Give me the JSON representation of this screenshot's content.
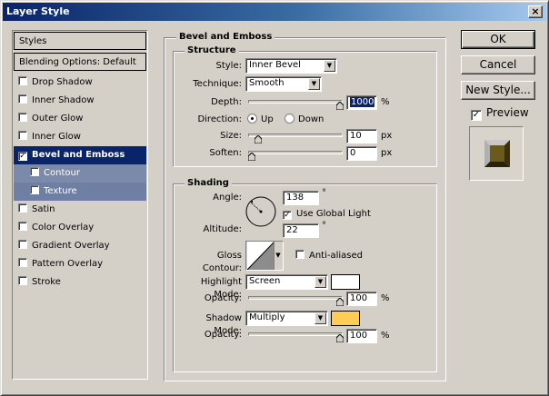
{
  "window": {
    "title": "Layer Style",
    "close_glyph": "×"
  },
  "styles_list": {
    "header": "Styles",
    "blending": "Blending Options: Default",
    "items": [
      {
        "label": "Drop Shadow",
        "checked": false
      },
      {
        "label": "Inner Shadow",
        "checked": false
      },
      {
        "label": "Outer Glow",
        "checked": false
      },
      {
        "label": "Inner Glow",
        "checked": false
      },
      {
        "label": "Bevel and Emboss",
        "checked": true
      },
      {
        "label": "Contour",
        "checked": false
      },
      {
        "label": "Texture",
        "checked": false
      },
      {
        "label": "Satin",
        "checked": false
      },
      {
        "label": "Color Overlay",
        "checked": false
      },
      {
        "label": "Gradient Overlay",
        "checked": false
      },
      {
        "label": "Pattern Overlay",
        "checked": false
      },
      {
        "label": "Stroke",
        "checked": false
      }
    ],
    "check_glyph": "✓"
  },
  "bevel": {
    "title": "Bevel and Emboss",
    "structure": {
      "title": "Structure",
      "style_label": "Style:",
      "style_value": "Inner Bevel",
      "technique_label": "Technique:",
      "technique_value": "Smooth",
      "depth_label": "Depth:",
      "depth_value": "1000",
      "depth_unit": "%",
      "direction_label": "Direction:",
      "dir_up": "Up",
      "dir_down": "Down",
      "size_label": "Size:",
      "size_value": "10",
      "size_unit": "px",
      "soften_label": "Soften:",
      "soften_value": "0",
      "soften_unit": "px",
      "depth_fraction": 1.0,
      "size_fraction": 0.07,
      "soften_fraction": 0.0
    },
    "shading": {
      "title": "Shading",
      "angle_label": "Angle:",
      "angle_value": "138",
      "degree": "°",
      "global_light_label": "Use Global Light",
      "global_light_checked": true,
      "altitude_label": "Altitude:",
      "altitude_value": "22",
      "gloss_label": "Gloss Contour:",
      "antialiased_label": "Anti-aliased",
      "highlight_label": "Highlight Mode:",
      "highlight_value": "Screen",
      "highlight_color": "#ffffff",
      "opacity_label": "Opacity:",
      "hl_opacity": "100",
      "percent": "%",
      "shadow_label": "Shadow Mode:",
      "shadow_value": "Multiply",
      "shadow_color": "#ffcc55",
      "sh_opacity": "100",
      "hl_opacity_fraction": 1.0,
      "sh_opacity_fraction": 1.0
    }
  },
  "buttons": {
    "ok": "OK",
    "cancel": "Cancel",
    "new_style": "New Style...",
    "preview_label": "Preview",
    "preview_checked": true
  },
  "arrow_glyph": "▼"
}
